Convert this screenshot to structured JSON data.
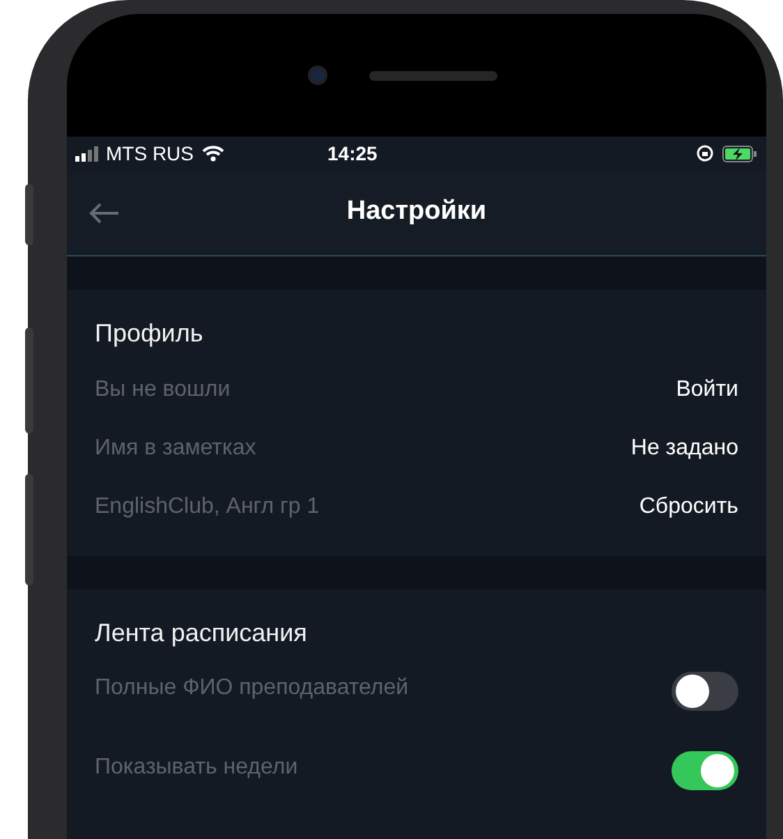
{
  "status_bar": {
    "carrier": "MTS RUS",
    "time": "14:25"
  },
  "nav_bar": {
    "title": "Настройки"
  },
  "sections": [
    {
      "title": "Профиль",
      "rows": [
        {
          "kind": "action",
          "label": "Вы не вошли",
          "value": "Войти"
        },
        {
          "kind": "action",
          "label": "Имя в заметках",
          "value": "Не задано"
        },
        {
          "kind": "action",
          "label": "EnglishClub, Англ гр 1",
          "value": "Сбросить"
        }
      ]
    },
    {
      "title": "Лента расписания",
      "rows": [
        {
          "kind": "toggle",
          "label": "Полные ФИО преподавателей",
          "on": false
        },
        {
          "kind": "toggle",
          "label": "Показывать недели",
          "on": true
        }
      ]
    }
  ]
}
